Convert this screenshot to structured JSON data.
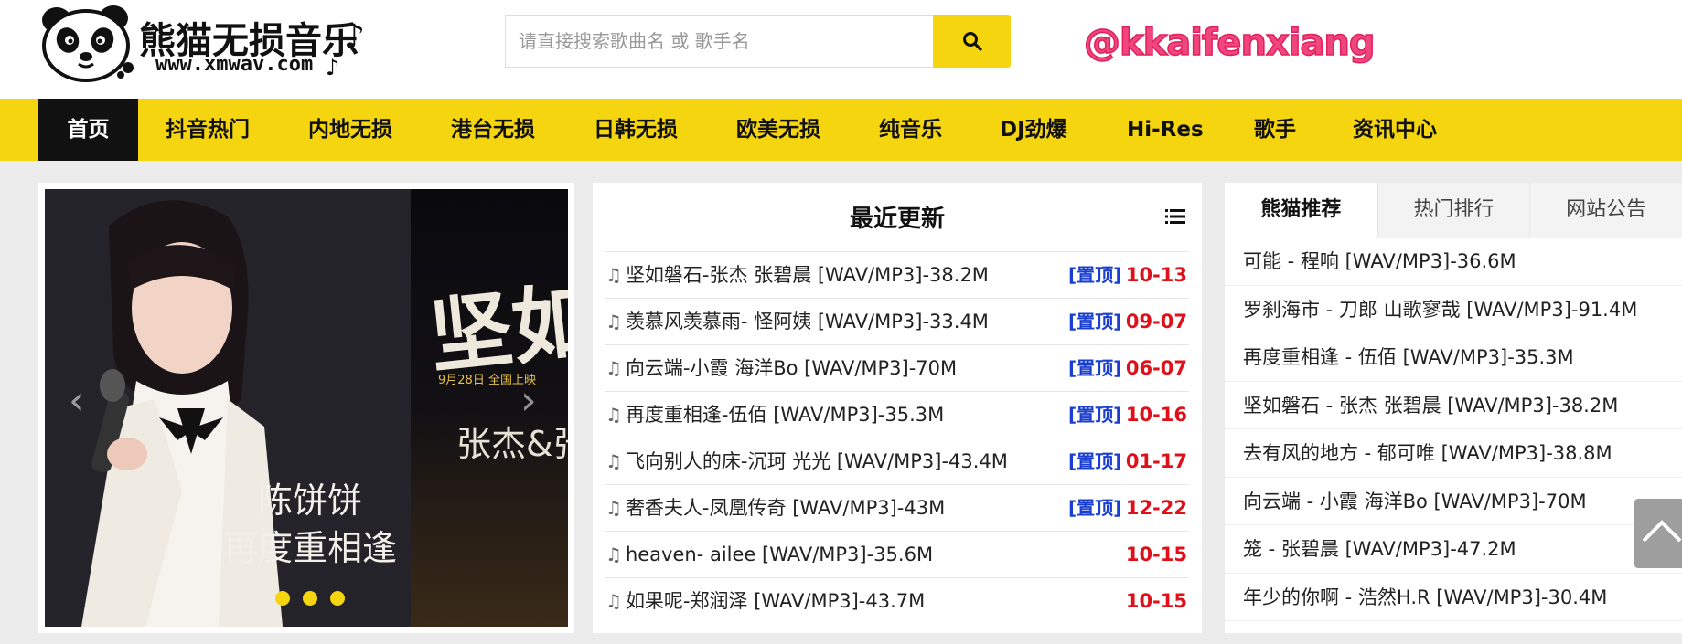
{
  "logo": {
    "title": "熊猫无损音乐",
    "url": "www.xmwav.com",
    "note_glyph": "♪"
  },
  "search": {
    "placeholder": "请直接搜索歌曲名 或 歌手名",
    "icon": "search-icon"
  },
  "watermark": "@kkaifenxiang",
  "nav": {
    "items": [
      {
        "label": "首页"
      },
      {
        "label": "抖音热门"
      },
      {
        "label": "内地无损"
      },
      {
        "label": "港台无损"
      },
      {
        "label": "日韩无损"
      },
      {
        "label": "欧美无损"
      },
      {
        "label": "纯音乐"
      },
      {
        "label": "DJ劲爆"
      },
      {
        "label": "Hi-Res"
      },
      {
        "label": "歌手"
      },
      {
        "label": "资讯中心"
      }
    ],
    "active_index": 0
  },
  "slider": {
    "caption_line1": "陈饼饼",
    "caption_line2": "再度重相逢",
    "poster_text": "张杰&张",
    "poster_big": "坚如",
    "poster_date": "9月28日 全国上映",
    "prev_glyph": "‹",
    "next_glyph": "›",
    "dots": 3
  },
  "updates": {
    "title": "最近更新",
    "pin_label": "[置顶]",
    "note_glyph": "♫",
    "items": [
      {
        "title": "坚如磐石-张杰 张碧晨 [WAV/MP3]-38.2M",
        "pinned": "[置顶]",
        "date": "10-13"
      },
      {
        "title": "羡慕风羡慕雨- 怪阿姨 [WAV/MP3]-33.4M",
        "pinned": "[置顶]",
        "date": "09-07"
      },
      {
        "title": "向云端-小霞 海洋Bo [WAV/MP3]-70M",
        "pinned": "[置顶]",
        "date": "06-07"
      },
      {
        "title": "再度重相逢-伍佰  [WAV/MP3]-35.3M",
        "pinned": "[置顶]",
        "date": "10-16"
      },
      {
        "title": "飞向别人的床-沉珂 光光 [WAV/MP3]-43.4M",
        "pinned": "[置顶]",
        "date": "01-17"
      },
      {
        "title": "奢香夫人-凤凰传奇  [WAV/MP3]-43M",
        "pinned": "[置顶]",
        "date": "12-22"
      },
      {
        "title": "heaven- ailee [WAV/MP3]-35.6M",
        "pinned": "",
        "date": "10-15"
      },
      {
        "title": "如果呢-郑润泽  [WAV/MP3]-43.7M",
        "pinned": "",
        "date": "10-15"
      }
    ]
  },
  "recommend": {
    "tabs": [
      {
        "label": "熊猫推荐"
      },
      {
        "label": "热门排行"
      },
      {
        "label": "网站公告"
      }
    ],
    "items": [
      "可能 - 程响  [WAV/MP3]-36.6M",
      "罗刹海市 - 刀郎 山歌寥哉 [WAV/MP3]-91.4M",
      "再度重相逢 - 伍佰  [WAV/MP3]-35.3M",
      "坚如磐石 - 张杰 张碧晨 [WAV/MP3]-38.2M",
      "去有风的地方 - 郁可唯  [WAV/MP3]-38.8M",
      "向云端 - 小霞 海洋Bo [WAV/MP3]-70M",
      "笼 - 张碧晨  [WAV/MP3]-47.2M",
      "年少的你啊 - 浩然H.R  [WAV/MP3]-30.4M"
    ]
  },
  "colors": {
    "accent": "#f4d50f",
    "pin": "#1a3fd0",
    "date": "#e0101a",
    "watermark": "#f0467d"
  }
}
